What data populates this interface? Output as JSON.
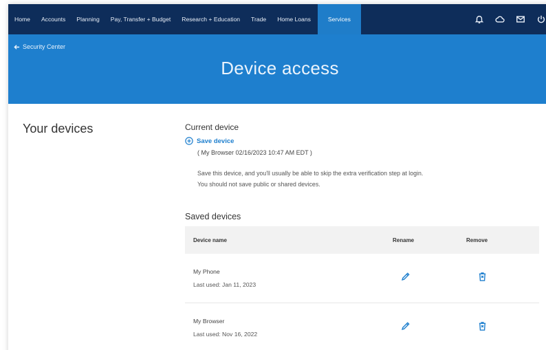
{
  "nav": {
    "items": [
      "Home",
      "Accounts",
      "Planning",
      "Pay, Transfer + Budget",
      "Research + Education",
      "Trade",
      "Home Loans",
      "Services"
    ],
    "active": "Services"
  },
  "banner": {
    "back_label": "Security Center",
    "title": "Device access"
  },
  "sidebar": {
    "heading": "Your devices"
  },
  "current_device": {
    "heading": "Current device",
    "save_label": "Save device",
    "browser_info": "( My Browser 02/16/2023 10:47 AM EDT )",
    "helper_line1": "Save this device, and you'll usually be able to skip the extra verification step at login.",
    "helper_line2": "You should not save public or shared devices."
  },
  "saved_devices": {
    "heading": "Saved devices",
    "columns": {
      "name": "Device name",
      "rename": "Rename",
      "remove": "Remove"
    },
    "rows": [
      {
        "name": "My Phone",
        "last_used": "Last used: Jan 11, 2023"
      },
      {
        "name": "My Browser",
        "last_used": "Last used: Nov 16, 2022"
      }
    ]
  },
  "colors": {
    "nav_bg": "#0e2d5a",
    "accent": "#1e7fce",
    "header_row": "#f2f2f2"
  },
  "icons": [
    "bell-icon",
    "cloud-icon",
    "mail-icon",
    "power-icon",
    "back-arrow-icon",
    "plus-circle-icon",
    "pencil-icon",
    "trash-icon"
  ]
}
